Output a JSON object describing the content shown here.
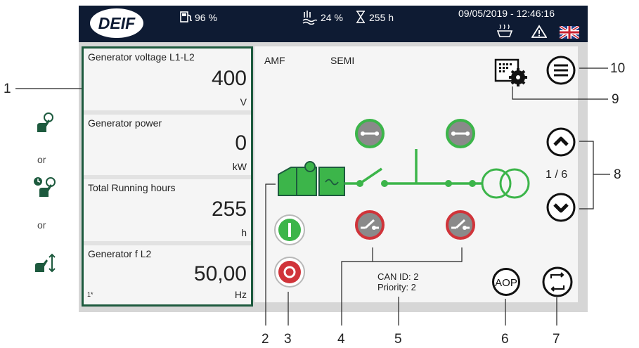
{
  "header": {
    "logo": "DEIF",
    "fuel": "96 %",
    "coolant": "24 %",
    "hours": "255 h",
    "datetime": "09/05/2019 - 12:46:16"
  },
  "left_panel": {
    "cards": [
      {
        "label": "Generator voltage L1-L2",
        "value": "400",
        "unit": "V"
      },
      {
        "label": "Generator power",
        "value": "0",
        "unit": "kW"
      },
      {
        "label": "Total Running hours",
        "value": "255",
        "unit": "h"
      },
      {
        "label": "Generator f L2",
        "value": "50,00",
        "unit": "Hz"
      }
    ],
    "corner_marker": "1*"
  },
  "main": {
    "mode_amf": "AMF",
    "mode_semi": "SEMI",
    "page_indicator": "1 / 6",
    "can_id": "CAN ID: 2",
    "priority": "Priority: 2",
    "aop_label": "AOP"
  },
  "side": {
    "or1": "or",
    "or2": "or"
  },
  "callouts": {
    "c1": "1",
    "c2": "2",
    "c3": "3",
    "c4": "4",
    "c5": "5",
    "c6": "6",
    "c7": "7",
    "c8": "8",
    "c9": "9",
    "c10": "10"
  },
  "colors": {
    "header_bg": "#0e1b33",
    "panel_border": "#1d5a3e",
    "green": "#3cb54a",
    "red": "#d0343a",
    "breaker_grey": "#8a8a8a"
  }
}
